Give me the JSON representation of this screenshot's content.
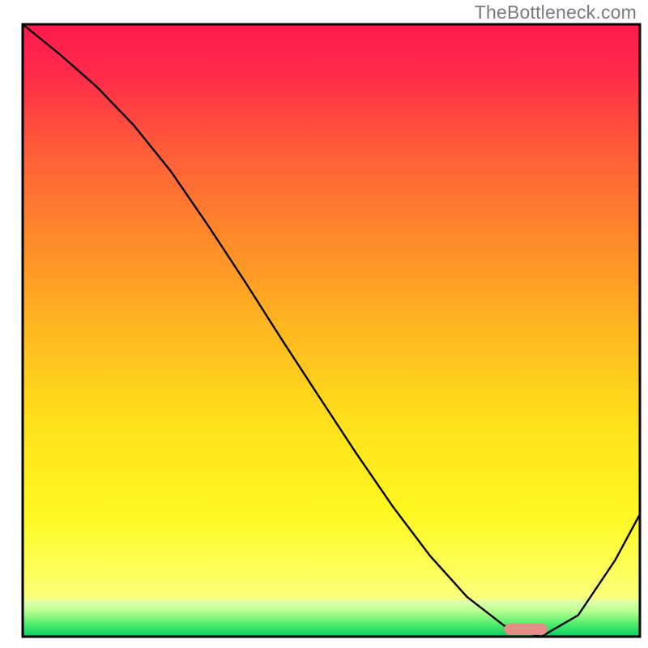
{
  "watermark": "TheBottleneck.com",
  "chart_data": {
    "type": "line",
    "title": "",
    "xlabel": "",
    "ylabel": "",
    "xlim": [
      0,
      100
    ],
    "ylim": [
      0,
      100
    ],
    "x": [
      0,
      6,
      12,
      18,
      24,
      30,
      36,
      42,
      48,
      54,
      60,
      66,
      72,
      78,
      84,
      90,
      96,
      100
    ],
    "y": [
      100,
      95.1,
      89.8,
      83.5,
      76.0,
      67.2,
      58.0,
      48.5,
      39.2,
      30.0,
      21.2,
      13.2,
      6.5,
      1.8,
      0.0,
      3.5,
      12.5,
      20.0
    ],
    "marker": {
      "x_start": 78,
      "x_end": 85,
      "y": 1.2
    },
    "green_band_top": 6.0,
    "notes": "Background is a vertical gradient from red at top through orange/yellow to pale yellow and a narrow green band at the bottom. A black curve descends from top-left with a slight slope break around x≈18, then roughly linearly falls to a minimum near x≈82, then rises toward the right edge. A short salmon-colored rounded bar sits at the curve's minimum."
  }
}
